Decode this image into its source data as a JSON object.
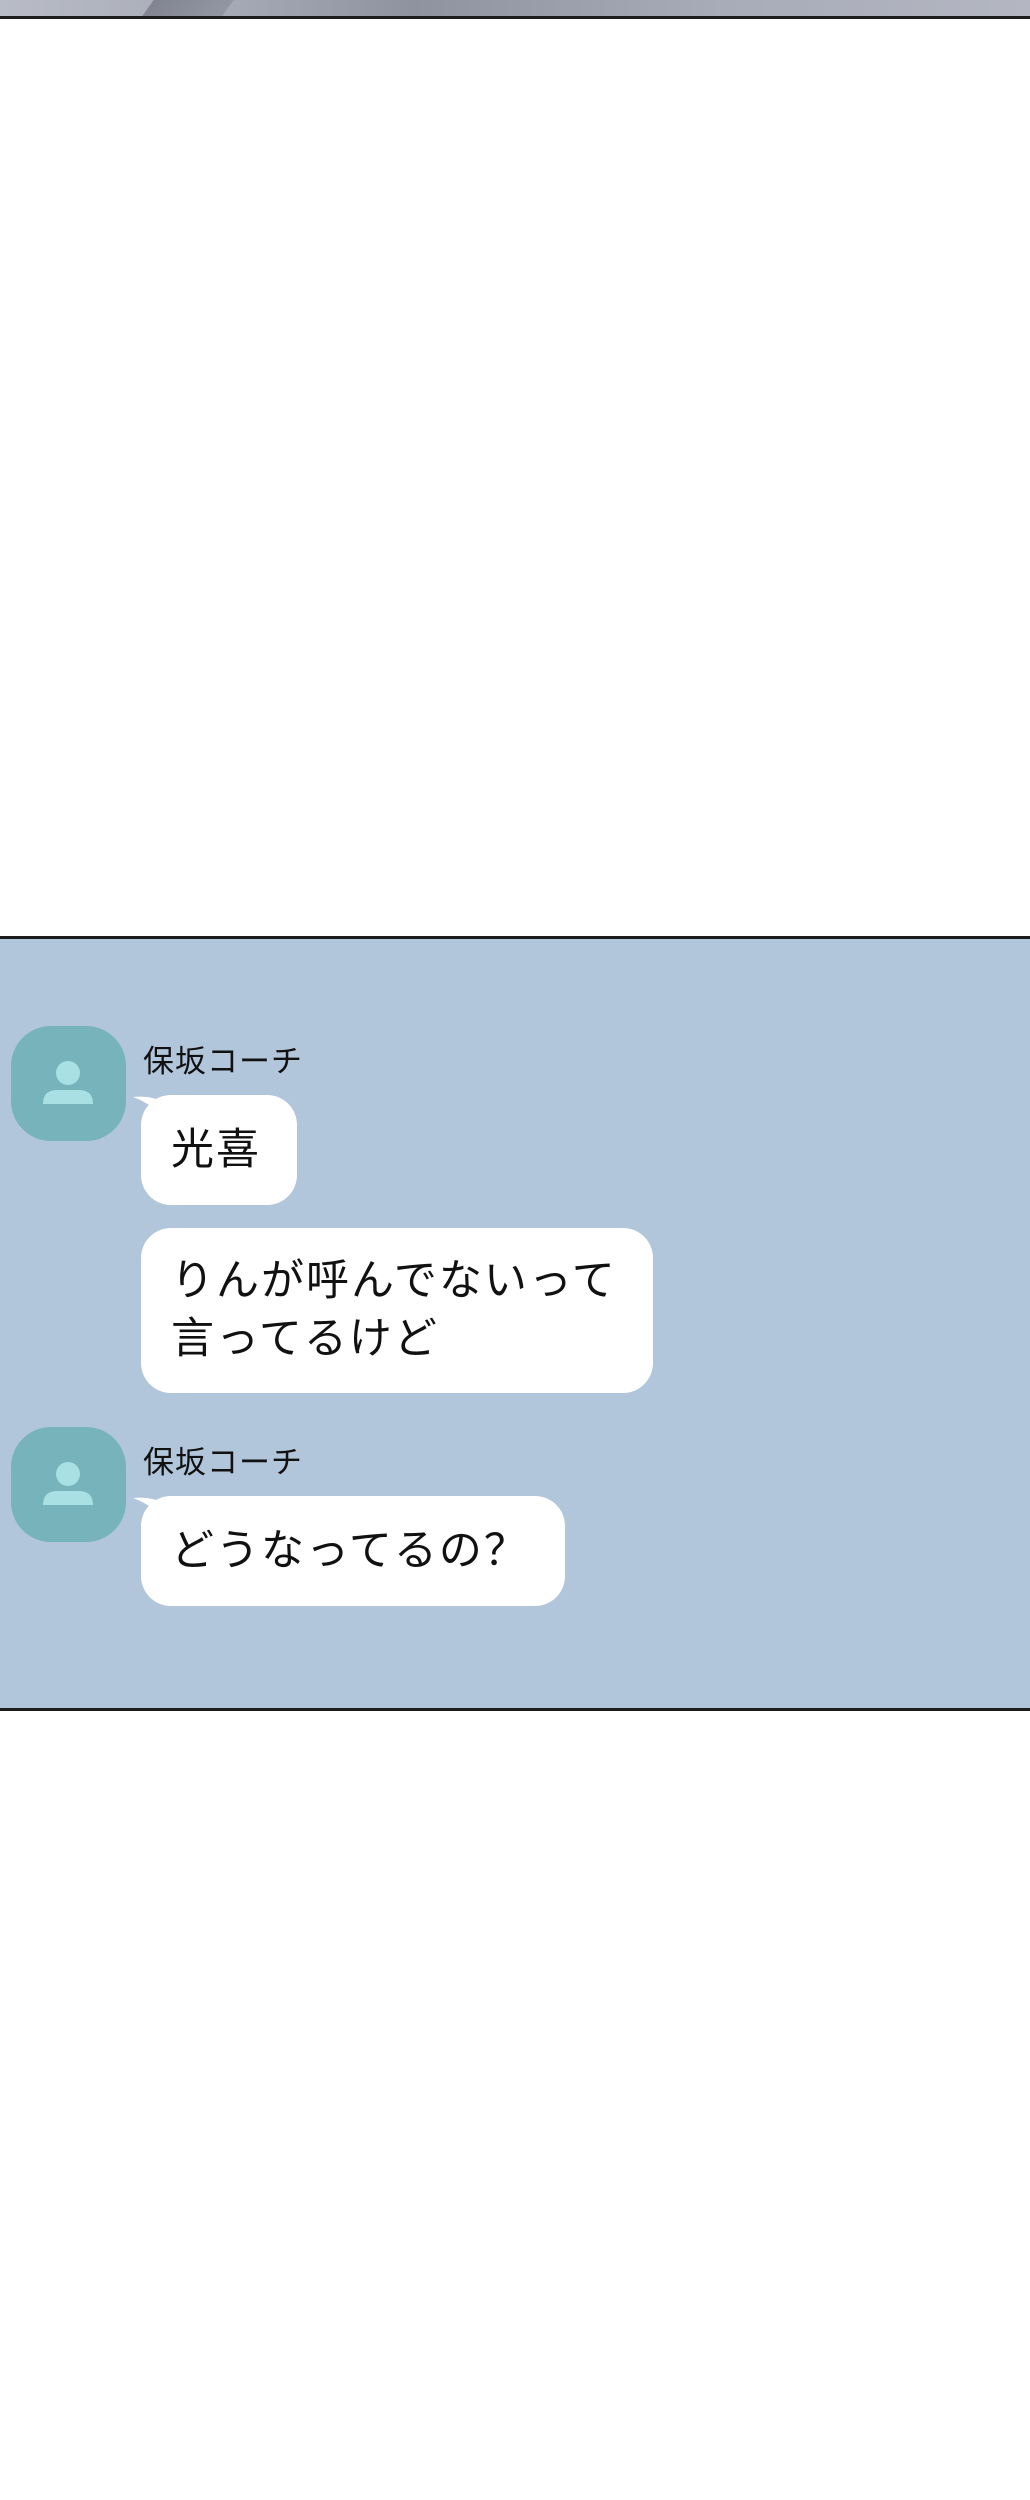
{
  "chat": {
    "messages": [
      {
        "sender": "保坂コーチ",
        "avatar_icon": "person-icon",
        "bubbles": [
          "光喜",
          "りんが呼んでないって\n言ってるけど"
        ]
      },
      {
        "sender": "保坂コーチ",
        "avatar_icon": "person-icon",
        "bubbles": [
          "どうなってるの？"
        ]
      }
    ]
  },
  "colors": {
    "chat_background": "#b1c5db",
    "avatar_background": "#76b3ba",
    "avatar_figure": "#a9e0e4",
    "bubble": "#ffffff",
    "text": "#111111"
  }
}
